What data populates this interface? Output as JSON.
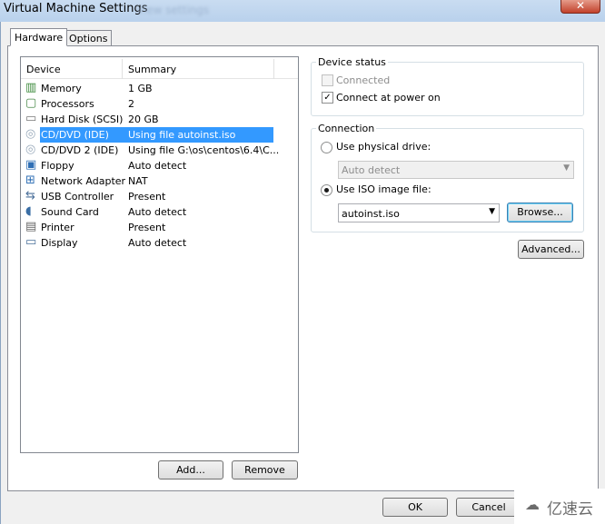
{
  "window": {
    "title": "Virtual Machine Settings",
    "ghost_title": "View settings",
    "close_icon": "close-icon"
  },
  "tabs": [
    {
      "label": "Hardware",
      "active": true
    },
    {
      "label": "Options",
      "active": false
    }
  ],
  "devices": {
    "headers": {
      "device": "Device",
      "summary": "Summary"
    },
    "rows": [
      {
        "device": "Memory",
        "summary": "1 GB",
        "icon": "memory-icon"
      },
      {
        "device": "Processors",
        "summary": "2",
        "icon": "processor-icon"
      },
      {
        "device": "Hard Disk (SCSI)",
        "summary": "20 GB",
        "icon": "hard-disk-icon"
      },
      {
        "device": "CD/DVD (IDE)",
        "summary": "Using file autoinst.iso",
        "icon": "cd-dvd-icon",
        "selected": true
      },
      {
        "device": "CD/DVD 2 (IDE)",
        "summary": "Using file G:\\os\\centos\\6.4\\C...",
        "icon": "cd-dvd-icon"
      },
      {
        "device": "Floppy",
        "summary": "Auto detect",
        "icon": "floppy-icon"
      },
      {
        "device": "Network Adapter",
        "summary": "NAT",
        "icon": "network-adapter-icon"
      },
      {
        "device": "USB Controller",
        "summary": "Present",
        "icon": "usb-icon"
      },
      {
        "device": "Sound Card",
        "summary": "Auto detect",
        "icon": "sound-card-icon"
      },
      {
        "device": "Printer",
        "summary": "Present",
        "icon": "printer-icon"
      },
      {
        "device": "Display",
        "summary": "Auto detect",
        "icon": "display-icon"
      }
    ],
    "add_label": "Add...",
    "remove_label": "Remove"
  },
  "device_status": {
    "title": "Device status",
    "connected": {
      "label": "Connected",
      "checked": false,
      "disabled": true
    },
    "connect_power_on": {
      "label": "Connect at power on",
      "checked": true
    }
  },
  "connection": {
    "title": "Connection",
    "physical": {
      "label": "Use physical drive:",
      "selected": false
    },
    "physical_value": "Auto detect",
    "iso": {
      "label": "Use ISO image file:",
      "selected": true
    },
    "iso_value": "autoinst.iso",
    "browse_label": "Browse..."
  },
  "advanced_label": "Advanced...",
  "footer": {
    "ok_label": "OK",
    "cancel_label": "Cancel"
  },
  "watermark": {
    "text": "亿速云"
  },
  "colors": {
    "selection": "#3399ff",
    "titlebar": "#c9dcf1"
  }
}
